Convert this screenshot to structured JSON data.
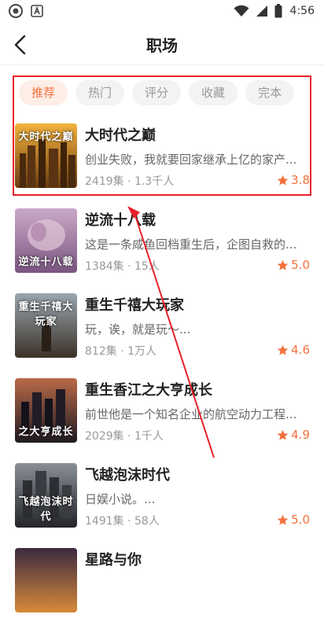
{
  "status_bar": {
    "time": "4:56",
    "icons": [
      "app-icon",
      "font-icon",
      "wifi-icon",
      "signal-icon",
      "battery-icon"
    ]
  },
  "header": {
    "title": "职场",
    "back_icon": "back-arrow-icon"
  },
  "tabs": [
    {
      "label": "推荐",
      "active": true
    },
    {
      "label": "热门",
      "active": false
    },
    {
      "label": "评分",
      "active": false
    },
    {
      "label": "收藏",
      "active": false
    },
    {
      "label": "完本",
      "active": false
    }
  ],
  "books": [
    {
      "title": "大时代之巅",
      "cover_text": "大时代之巅",
      "desc": "创业失败，我就要回家继承上亿的家产...",
      "episodes": "2419集",
      "viewers": "1.3千人",
      "meta_sep": "·",
      "rating": "3.8"
    },
    {
      "title": "逆流十八载",
      "cover_text": "逆流十八载",
      "desc": "这是一条咸鱼回档重生后，企图自救的...",
      "episodes": "1384集",
      "viewers": "15人",
      "meta_sep": "·",
      "rating": "5.0"
    },
    {
      "title": "重生千禧大玩家",
      "cover_text": "重生千禧大玩家",
      "desc": "玩，诶，就是玩～...",
      "episodes": "812集",
      "viewers": "1万人",
      "meta_sep": "·",
      "rating": "4.6"
    },
    {
      "title": "重生香江之大亨成长",
      "cover_text": "之大亨成长",
      "desc": "前世他是一个知名企业的航空动力工程...",
      "episodes": "2029集",
      "viewers": "1千人",
      "meta_sep": "·",
      "rating": "4.9"
    },
    {
      "title": "飞越泡沫时代",
      "cover_text": "飞越泡沫时代",
      "desc": "日娱小说。...",
      "episodes": "1491集",
      "viewers": "58人",
      "meta_sep": "·",
      "rating": "5.0"
    },
    {
      "title": "星路与你",
      "cover_text": "",
      "desc": "",
      "episodes": "",
      "viewers": "",
      "meta_sep": "",
      "rating": ""
    }
  ],
  "colors": {
    "accent": "#f2703d",
    "highlight_box": "#e8202a",
    "tab_active_bg": "#fdeee7",
    "tab_bg": "#f3f3f3"
  }
}
